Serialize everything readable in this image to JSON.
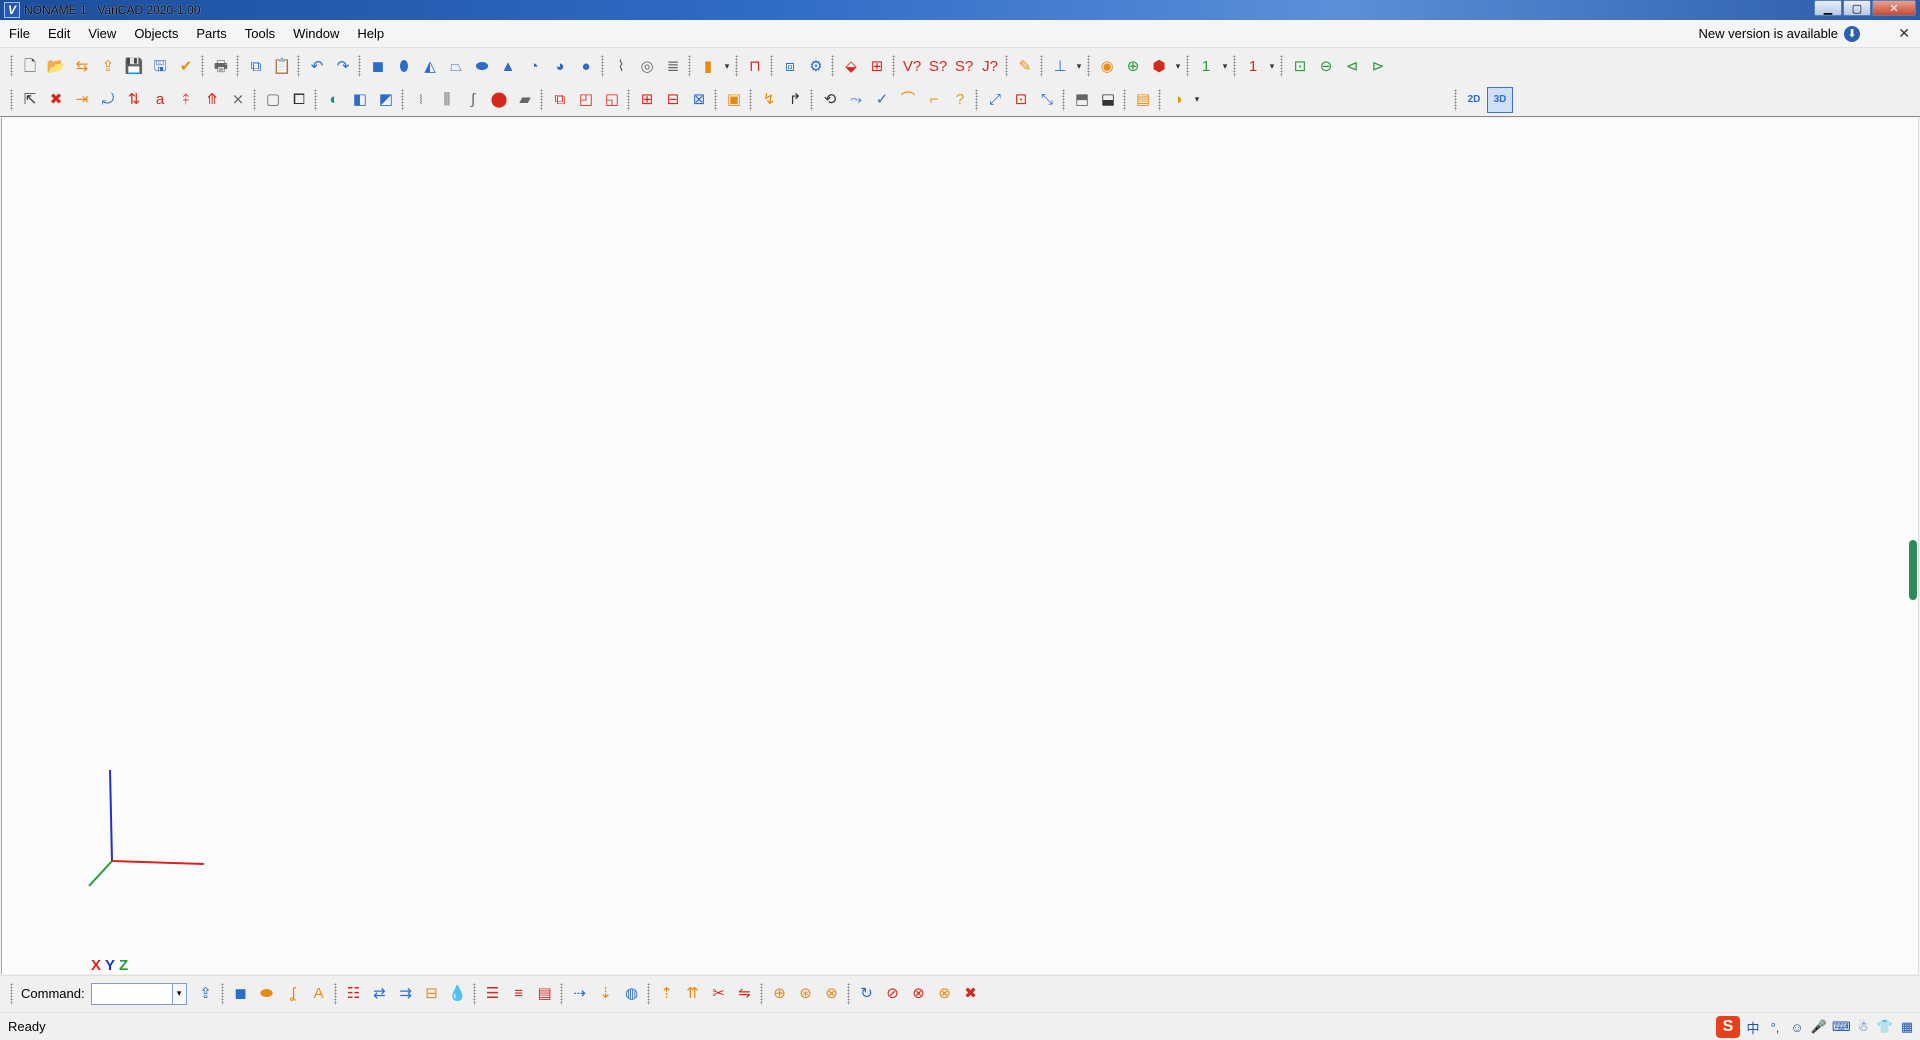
{
  "window": {
    "title": "NONAME 1 - VariCAD 2020-1.00",
    "app_icon": "V",
    "minimize": "▁",
    "maximize": "▢",
    "close": "✕"
  },
  "menu": {
    "items": [
      "File",
      "Edit",
      "View",
      "Objects",
      "Parts",
      "Tools",
      "Window",
      "Help"
    ],
    "new_version": "New version is available",
    "download_icon": "⬇",
    "close": "✕"
  },
  "toolbar1": {
    "icons": [
      {
        "name": "new-file-icon",
        "glyph": "🗋",
        "color": "dark"
      },
      {
        "name": "open-file-icon",
        "glyph": "📂",
        "color": "orange"
      },
      {
        "name": "open-recent-icon",
        "glyph": "⇆",
        "color": "orange"
      },
      {
        "name": "open-folder-icon",
        "glyph": "⇪",
        "color": "orange"
      },
      {
        "name": "save-icon",
        "glyph": "💾",
        "color": "blue"
      },
      {
        "name": "save-all-icon",
        "glyph": "🖫",
        "color": "blue"
      },
      {
        "name": "save-as-icon",
        "glyph": "✔",
        "color": "orange"
      },
      {
        "sep": true
      },
      {
        "name": "print-icon",
        "glyph": "🖶",
        "color": "gray"
      },
      {
        "sep": true
      },
      {
        "name": "copy-icon",
        "glyph": "⧉",
        "color": "blue"
      },
      {
        "name": "paste-icon",
        "glyph": "📋",
        "color": "blue"
      },
      {
        "sep": true
      },
      {
        "name": "undo-icon",
        "glyph": "↶",
        "color": "blue"
      },
      {
        "name": "redo-icon",
        "glyph": "↷",
        "color": "blue"
      },
      {
        "sep": true
      },
      {
        "name": "box-solid-icon",
        "glyph": "◼",
        "color": "blue"
      },
      {
        "name": "cylinder-solid-icon",
        "glyph": "⬮",
        "color": "blue"
      },
      {
        "name": "cone-solid-icon",
        "glyph": "◭",
        "color": "blue"
      },
      {
        "name": "truncated-cone-icon",
        "glyph": "⏢",
        "color": "blue"
      },
      {
        "name": "pipe-solid-icon",
        "glyph": "⬬",
        "color": "blue"
      },
      {
        "name": "pyramid-solid-icon",
        "glyph": "▲",
        "color": "blue"
      },
      {
        "name": "torus-solid-icon",
        "glyph": "◔",
        "color": "blue"
      },
      {
        "name": "ellipsoid-solid-icon",
        "glyph": "◕",
        "color": "blue"
      },
      {
        "name": "sphere-solid-icon",
        "glyph": "●",
        "color": "blue"
      },
      {
        "sep": true
      },
      {
        "name": "spring-icon",
        "glyph": "⌇",
        "color": "gray"
      },
      {
        "name": "bearing-icon",
        "glyph": "◎",
        "color": "gray"
      },
      {
        "name": "coil-icon",
        "glyph": "≣",
        "color": "gray"
      },
      {
        "sep": true
      },
      {
        "name": "library-part-icon",
        "glyph": "▮",
        "color": "orange"
      },
      {
        "name": "library-dropdown-icon",
        "glyph": "▾",
        "color": "dark",
        "small": true
      },
      {
        "sep": true
      },
      {
        "name": "magnet-icon",
        "glyph": "⊓",
        "color": "red"
      },
      {
        "sep": true
      },
      {
        "name": "assembly-link-icon",
        "glyph": "⧈",
        "color": "blue"
      },
      {
        "name": "assembly-settings-icon",
        "glyph": "⚙",
        "color": "blue"
      },
      {
        "sep": true
      },
      {
        "name": "solid-move-icon",
        "glyph": "⬙",
        "color": "red"
      },
      {
        "name": "solid-grid-icon",
        "glyph": "⊞",
        "color": "red"
      },
      {
        "sep": true
      },
      {
        "name": "volume-query-icon",
        "glyph": "V?",
        "color": "red"
      },
      {
        "name": "surface-query-icon",
        "glyph": "S?",
        "color": "red"
      },
      {
        "name": "section-query-icon",
        "glyph": "S?",
        "color": "red"
      },
      {
        "name": "joint-query-icon",
        "glyph": "J?",
        "color": "red"
      },
      {
        "sep": true
      },
      {
        "name": "eraser-icon",
        "glyph": "✎",
        "color": "orange"
      },
      {
        "sep": true
      },
      {
        "name": "measure-icon",
        "glyph": "⊥",
        "color": "blue"
      },
      {
        "name": "measure-dropdown-icon",
        "glyph": "▾",
        "color": "dark",
        "small": true
      },
      {
        "sep": true
      },
      {
        "name": "view-previous-icon",
        "glyph": "◉",
        "color": "orange"
      },
      {
        "name": "zoom-window-icon",
        "glyph": "⊕",
        "color": "green"
      },
      {
        "name": "view-cube-icon",
        "glyph": "⬢",
        "color": "red"
      },
      {
        "name": "view-cube-dropdown-icon",
        "glyph": "▾",
        "color": "dark",
        "small": true
      },
      {
        "sep": true
      },
      {
        "name": "layer-one-icon",
        "glyph": "1",
        "color": "green"
      },
      {
        "name": "layer-one-dropdown-icon",
        "glyph": "▾",
        "color": "dark",
        "small": true
      },
      {
        "sep": true
      },
      {
        "name": "layer-red-icon",
        "glyph": "1",
        "color": "red"
      },
      {
        "name": "layer-red-dropdown-icon",
        "glyph": "▾",
        "color": "dark",
        "small": true
      },
      {
        "sep": true
      },
      {
        "name": "zoom-all-icon",
        "glyph": "⊡",
        "color": "green"
      },
      {
        "name": "zoom-out-icon",
        "glyph": "⊖",
        "color": "green"
      },
      {
        "name": "zoom-previous-icon",
        "glyph": "⊲",
        "color": "green"
      },
      {
        "name": "zoom-next-icon",
        "glyph": "⊳",
        "color": "green"
      }
    ]
  },
  "toolbar2": {
    "icons": [
      {
        "name": "select-object-icon",
        "glyph": "⇱",
        "color": "dark"
      },
      {
        "name": "delete-icon",
        "glyph": "✖",
        "color": "red"
      },
      {
        "name": "move-icon",
        "glyph": "⇥",
        "color": "orange"
      },
      {
        "name": "rotate-icon",
        "glyph": "⤾",
        "color": "blue"
      },
      {
        "name": "mirror-icon",
        "glyph": "⇅",
        "color": "red"
      },
      {
        "name": "text-attribute-icon",
        "glyph": "a",
        "color": "red"
      },
      {
        "name": "transform-icon",
        "glyph": "⤉",
        "color": "red"
      },
      {
        "name": "copy-transform-icon",
        "glyph": "⤊",
        "color": "red"
      },
      {
        "name": "snap-icon",
        "glyph": "⨯",
        "color": "gray"
      },
      {
        "sep": true
      },
      {
        "name": "wire-box-icon",
        "glyph": "▢",
        "color": "gray"
      },
      {
        "name": "wire-cube-icon",
        "glyph": "⧠",
        "color": "dark"
      },
      {
        "sep": true
      },
      {
        "name": "color-palette-icon",
        "glyph": "◐",
        "color": "teal"
      },
      {
        "name": "shading-icon",
        "glyph": "◧",
        "color": "blue"
      },
      {
        "name": "shading-box-icon",
        "glyph": "◩",
        "color": "blue"
      },
      {
        "sep": true
      },
      {
        "name": "thread-icon",
        "glyph": "⧙",
        "color": "gray"
      },
      {
        "name": "multi-thread-icon",
        "glyph": "⫼",
        "color": "gray"
      },
      {
        "name": "hook-icon",
        "glyph": "ʃ",
        "color": "gray"
      },
      {
        "name": "red-solid-icon",
        "glyph": "⬤",
        "color": "red"
      },
      {
        "name": "plate-icon",
        "glyph": "▰",
        "color": "gray"
      },
      {
        "sep": true
      },
      {
        "name": "boolean-add-icon",
        "glyph": "⧉",
        "color": "red"
      },
      {
        "name": "boolean-cut-icon",
        "glyph": "◰",
        "color": "red"
      },
      {
        "name": "boolean-intersect-icon",
        "glyph": "◱",
        "color": "red"
      },
      {
        "sep": true
      },
      {
        "name": "group-add-icon",
        "glyph": "⊞",
        "color": "red"
      },
      {
        "name": "group-remove-icon",
        "glyph": "⊟",
        "color": "red"
      },
      {
        "name": "group-edit-icon",
        "glyph": "⊠",
        "color": "blue"
      },
      {
        "sep": true
      },
      {
        "name": "frame-icon",
        "glyph": "▣",
        "color": "orange"
      },
      {
        "sep": true
      },
      {
        "name": "fold-query-icon",
        "glyph": "↯",
        "color": "orange"
      },
      {
        "name": "unfold-query-icon",
        "glyph": "↱",
        "color": "dark"
      },
      {
        "sep": true
      },
      {
        "name": "path-edit-icon",
        "glyph": "⟲",
        "color": "dark"
      },
      {
        "name": "path-query-icon",
        "glyph": "⤳",
        "color": "blue"
      },
      {
        "name": "line-check-icon",
        "glyph": "✓",
        "color": "blue"
      },
      {
        "name": "edge-fillet-icon",
        "glyph": "⌒",
        "color": "orange"
      },
      {
        "name": "edge-chamfer-icon",
        "glyph": "⌐",
        "color": "orange"
      },
      {
        "name": "edge-query-icon",
        "glyph": "?",
        "color": "yellow"
      },
      {
        "sep": true
      },
      {
        "name": "axis-move-icon",
        "glyph": "⤢",
        "color": "blue"
      },
      {
        "name": "dimension-box-icon",
        "glyph": "⊡",
        "color": "red"
      },
      {
        "name": "dimension-arrow-icon",
        "glyph": "⤡",
        "color": "blue"
      },
      {
        "sep": true
      },
      {
        "name": "section-view-icon",
        "glyph": "⬒",
        "color": "gray"
      },
      {
        "name": "section-transfer-icon",
        "glyph": "⬓",
        "color": "dark"
      },
      {
        "sep": true
      },
      {
        "name": "clipboard-3d-icon",
        "glyph": "▤",
        "color": "orange"
      },
      {
        "sep": true
      },
      {
        "name": "center-of-mass-icon",
        "glyph": "◑",
        "color": "yellow"
      },
      {
        "name": "center-mass-dropdown-icon",
        "glyph": "▾",
        "color": "dark",
        "small": true
      }
    ],
    "right": [
      {
        "name": "mode-2d-icon",
        "glyph": "2D",
        "pressed": false
      },
      {
        "name": "mode-3d-icon",
        "glyph": "3D",
        "pressed": true
      }
    ]
  },
  "axes": {
    "x_label": "X",
    "y_label": "Y",
    "z_label": "Z",
    "x_color": "#e02020",
    "y_color": "#2030d0",
    "z_color": "#20a030"
  },
  "command": {
    "label": "Command:",
    "value": "",
    "dropdown": "▾",
    "icons": [
      {
        "name": "export-icon",
        "glyph": "⇪",
        "color": "blue"
      },
      {
        "sep": true
      },
      {
        "name": "solid-box-icon",
        "glyph": "◼",
        "color": "blue"
      },
      {
        "name": "pipe-bend-icon",
        "glyph": "⬬",
        "color": "orange"
      },
      {
        "name": "hook-bend-icon",
        "glyph": "ʆ",
        "color": "orange"
      },
      {
        "name": "text-3d-icon",
        "glyph": "A",
        "color": "orange"
      },
      {
        "sep": true
      },
      {
        "name": "assembly-tree-icon",
        "glyph": "☷",
        "color": "red"
      },
      {
        "name": "assembly-link-2-icon",
        "glyph": "⇄",
        "color": "blue"
      },
      {
        "name": "assembly-move-icon",
        "glyph": "⇉",
        "color": "blue"
      },
      {
        "name": "assembly-folder-icon",
        "glyph": "⊟",
        "color": "orange"
      },
      {
        "name": "water-drop-icon",
        "glyph": "💧",
        "color": "blue"
      },
      {
        "sep": true
      },
      {
        "name": "bom-red-icon",
        "glyph": "☰",
        "color": "red"
      },
      {
        "name": "bom-list-icon",
        "glyph": "≡",
        "color": "red"
      },
      {
        "name": "bom-table-icon",
        "glyph": "▤",
        "color": "red"
      },
      {
        "sep": true
      },
      {
        "name": "sheet-open-icon",
        "glyph": "⇢",
        "color": "blue"
      },
      {
        "name": "sheet-flat-icon",
        "glyph": "⇣",
        "color": "orange"
      },
      {
        "name": "sheet-roll-icon",
        "glyph": "◍",
        "color": "blue"
      },
      {
        "sep": true
      },
      {
        "name": "pipe-up-icon",
        "glyph": "⇡",
        "color": "orange"
      },
      {
        "name": "pipe-branch-icon",
        "glyph": "⇈",
        "color": "orange"
      },
      {
        "name": "pipe-cut-icon",
        "glyph": "✂",
        "color": "red"
      },
      {
        "name": "pipe-join-icon",
        "glyph": "⇋",
        "color": "red"
      },
      {
        "sep": true
      },
      {
        "name": "weld-add-icon",
        "glyph": "⊕",
        "color": "orange"
      },
      {
        "name": "weld-edit-icon",
        "glyph": "⊛",
        "color": "orange"
      },
      {
        "name": "weld-remove-icon",
        "glyph": "⊗",
        "color": "orange"
      },
      {
        "sep": true
      },
      {
        "name": "refresh-icon",
        "glyph": "↻",
        "color": "blue"
      },
      {
        "name": "cancel-refresh-icon",
        "glyph": "⊘",
        "color": "red"
      },
      {
        "name": "cancel-all-icon",
        "glyph": "⊗",
        "color": "red"
      },
      {
        "name": "cancel-orange-icon",
        "glyph": "⊗",
        "color": "orange"
      },
      {
        "name": "cancel-red-icon",
        "glyph": "✖",
        "color": "red"
      }
    ]
  },
  "status": {
    "text": "Ready",
    "tray": [
      {
        "name": "ime-sogou-icon",
        "glyph": "S"
      },
      {
        "name": "ime-chinese-icon",
        "glyph": "中"
      },
      {
        "name": "ime-punct-icon",
        "glyph": "°,"
      },
      {
        "name": "ime-emoji-icon",
        "glyph": "☺"
      },
      {
        "name": "ime-mic-icon",
        "glyph": "🎤"
      },
      {
        "name": "ime-keyboard-icon",
        "glyph": "⌨"
      },
      {
        "name": "ime-user-icon",
        "glyph": "☃"
      },
      {
        "name": "ime-shirt-icon",
        "glyph": "👕"
      },
      {
        "name": "ime-grid-icon",
        "glyph": "▦"
      }
    ]
  }
}
